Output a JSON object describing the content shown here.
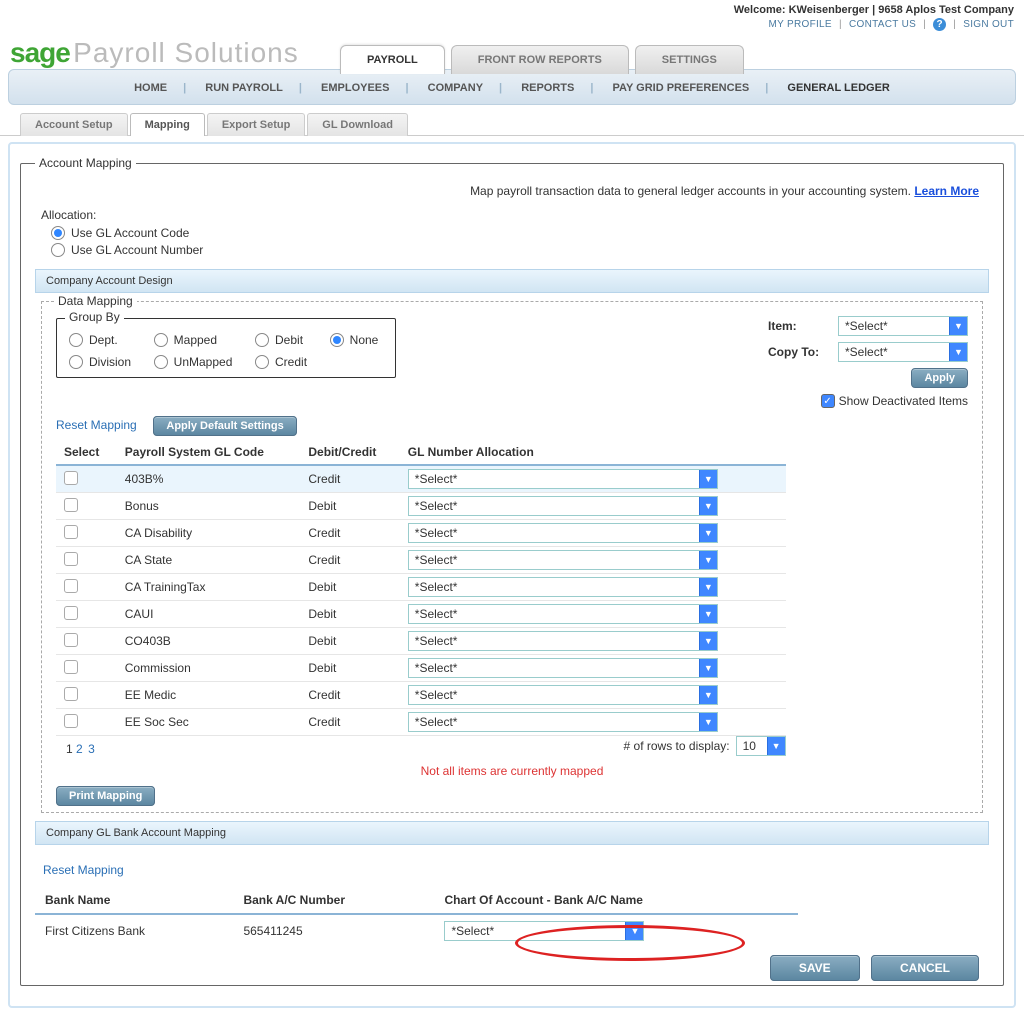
{
  "welcome": {
    "prefix": "Welcome:",
    "user": "KWeisenberger",
    "company": "9658 Aplos Test Company"
  },
  "top_links": {
    "profile": "MY PROFILE",
    "contact": "CONTACT US",
    "signout": "SIGN OUT"
  },
  "brand": {
    "sage": "sage",
    "product": "Payroll Solutions"
  },
  "main_tabs": {
    "payroll": "PAYROLL",
    "reports": "FRONT ROW REPORTS",
    "settings": "SETTINGS"
  },
  "menu": {
    "home": "HOME",
    "run_payroll": "RUN PAYROLL",
    "employees": "EMPLOYEES",
    "company": "COMPANY",
    "reports": "REPORTS",
    "pay_grid": "PAY GRID PREFERENCES",
    "general_ledger": "GENERAL LEDGER"
  },
  "sub_tabs": {
    "account_setup": "Account Setup",
    "mapping": "Mapping",
    "export_setup": "Export Setup",
    "gl_download": "GL Download"
  },
  "fieldset_legend": "Account Mapping",
  "intro_text": "Map payroll transaction data to general ledger accounts in your accounting system. ",
  "learn_more": "Learn More",
  "allocation": {
    "title": "Allocation:",
    "opt1": "Use GL Account Code",
    "opt2": "Use GL Account Number"
  },
  "company_design": "Company Account Design",
  "data_mapping_legend": "Data Mapping",
  "group_by": {
    "legend": "Group By",
    "dept": "Dept.",
    "mapped": "Mapped",
    "debit": "Debit",
    "none": "None",
    "division": "Division",
    "unmapped": "UnMapped",
    "credit": "Credit"
  },
  "right": {
    "item": "Item:",
    "copy_to": "Copy To:",
    "select": "*Select*",
    "apply": "Apply",
    "show_deact": "Show Deactivated Items"
  },
  "links": {
    "reset_mapping": "Reset Mapping",
    "apply_default": "Apply Default Settings"
  },
  "table": {
    "h_select": "Select",
    "h_code": "Payroll System GL Code",
    "h_dc": "Debit/Credit",
    "h_gl": "GL Number Allocation",
    "select_ph": "*Select*",
    "rows": [
      {
        "code": "403B%",
        "dc": "Credit",
        "hl": true
      },
      {
        "code": "Bonus",
        "dc": "Debit"
      },
      {
        "code": "CA Disability",
        "dc": "Credit"
      },
      {
        "code": "CA State",
        "dc": "Credit"
      },
      {
        "code": "CA TrainingTax",
        "dc": "Debit"
      },
      {
        "code": "CAUI",
        "dc": "Debit"
      },
      {
        "code": "CO403B",
        "dc": "Debit"
      },
      {
        "code": "Commission",
        "dc": "Debit"
      },
      {
        "code": "EE Medic",
        "dc": "Credit"
      },
      {
        "code": "EE Soc Sec",
        "dc": "Credit"
      }
    ]
  },
  "pager": {
    "p1": "1",
    "p2": "2",
    "p3": "3"
  },
  "rows_display": {
    "label": "# of rows to display:",
    "value": "10"
  },
  "warning": "Not all items are currently mapped",
  "print_mapping": "Print Mapping",
  "bank": {
    "section": "Company GL Bank Account Mapping",
    "reset": "Reset Mapping",
    "h_name": "Bank Name",
    "h_num": "Bank A/C Number",
    "h_chart": "Chart Of Account - Bank A/C Name",
    "row_name": "First Citizens Bank",
    "row_num": "565411245",
    "select_ph": "*Select*"
  },
  "footer": {
    "save": "SAVE",
    "cancel": "CANCEL"
  }
}
